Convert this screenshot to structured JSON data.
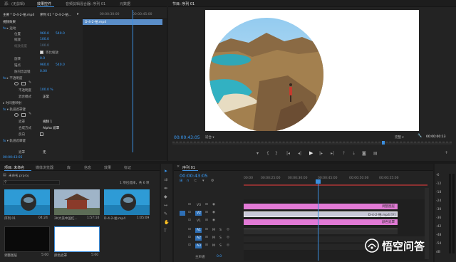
{
  "source_panel": {
    "tabs": [
      {
        "label": "源：(无剪辑)"
      },
      {
        "label": "效果控件"
      },
      {
        "label": "音频剪辑混合器: 序列 01"
      },
      {
        "label": "元数据"
      }
    ],
    "clip_path": "主要 * D-4-2-拍.mp4",
    "clip_target": "序列 01 * D-4-2-拍...",
    "ruler": [
      "00:00:30:00",
      "00:00:45:00"
    ],
    "clip_bar": "D-4-2-拍.mp4",
    "section_video": "视频效果",
    "fx_motion": "运动",
    "rows": [
      {
        "name": "位置",
        "v1": "960.0",
        "v2": "540.0"
      },
      {
        "name": "缩放",
        "v1": "100.0"
      },
      {
        "name": "缩放宽度",
        "v1": "100.0"
      },
      {
        "name": "等比缩放"
      },
      {
        "name": "旋转",
        "v1": "0.0"
      },
      {
        "name": "锚点",
        "v1": "960.0",
        "v2": "540.0"
      },
      {
        "name": "防闪烁滤镜",
        "v1": "0.00"
      }
    ],
    "fx_opacity": "不透明度",
    "opacity": {
      "name": "不透明度",
      "value": "100.0 %"
    },
    "blend": {
      "name": "混合模式",
      "value": "正常"
    },
    "time_remap": "时间重映射",
    "track_matte": "轨道遮罩键",
    "matte_rows": [
      {
        "name": "遮罩",
        "value": "视频 1"
      },
      {
        "name": "合成方式",
        "value": "Alpha 遮罩"
      },
      {
        "name": "反向"
      }
    ],
    "track_matte2": "轨道遮罩键",
    "matte2": {
      "name": "遮罩",
      "value": "无"
    },
    "timecode": "00:00:43:05"
  },
  "program": {
    "title": "节目: 序列 01",
    "timecode": "00:00:43:05",
    "fit": "适合",
    "quality": "完整",
    "duration": "00:00:00:13"
  },
  "project": {
    "tabs": [
      {
        "label": "项目: 未命名"
      },
      {
        "label": "媒体浏览器"
      },
      {
        "label": "库"
      },
      {
        "label": "信息"
      },
      {
        "label": "效果"
      },
      {
        "label": "标记"
      }
    ],
    "file": "未命名.prproj",
    "status": "1 项已选择，共 6 项",
    "items": [
      {
        "name": "序列 01",
        "dur": "04:24"
      },
      {
        "name": "2K大美中国红...",
        "dur": "1:57:10"
      },
      {
        "name": "D-4-2-拍.mp4",
        "dur": "1:05:09"
      },
      {
        "name": "调整图层",
        "dur": "5:00"
      },
      {
        "name": "颜色遮罩",
        "dur": "5:00"
      }
    ]
  },
  "timeline": {
    "tab": "序列 01",
    "timecode": "00:00:43:05",
    "ruler": [
      "00:00",
      "00:00:25:00",
      "00:00:30:00",
      "00:00:45:00",
      "00:00:50:00",
      "00:00:55:00"
    ],
    "tracks": [
      {
        "name": "V3",
        "clip": "调整图层"
      },
      {
        "name": "V2",
        "clip": "D-4-2-拍.mp4 [V]"
      },
      {
        "name": "V1",
        "clip": "颜色遮罩"
      },
      {
        "name": "A1"
      },
      {
        "name": "A2"
      },
      {
        "name": "A3"
      }
    ],
    "master": "主声道",
    "master_val": "0.0"
  },
  "watermark": "悟空问答",
  "meter": [
    "-6",
    "-12",
    "-18",
    "-24",
    "-30",
    "-36",
    "-42",
    "-48",
    "-54",
    "dB"
  ]
}
